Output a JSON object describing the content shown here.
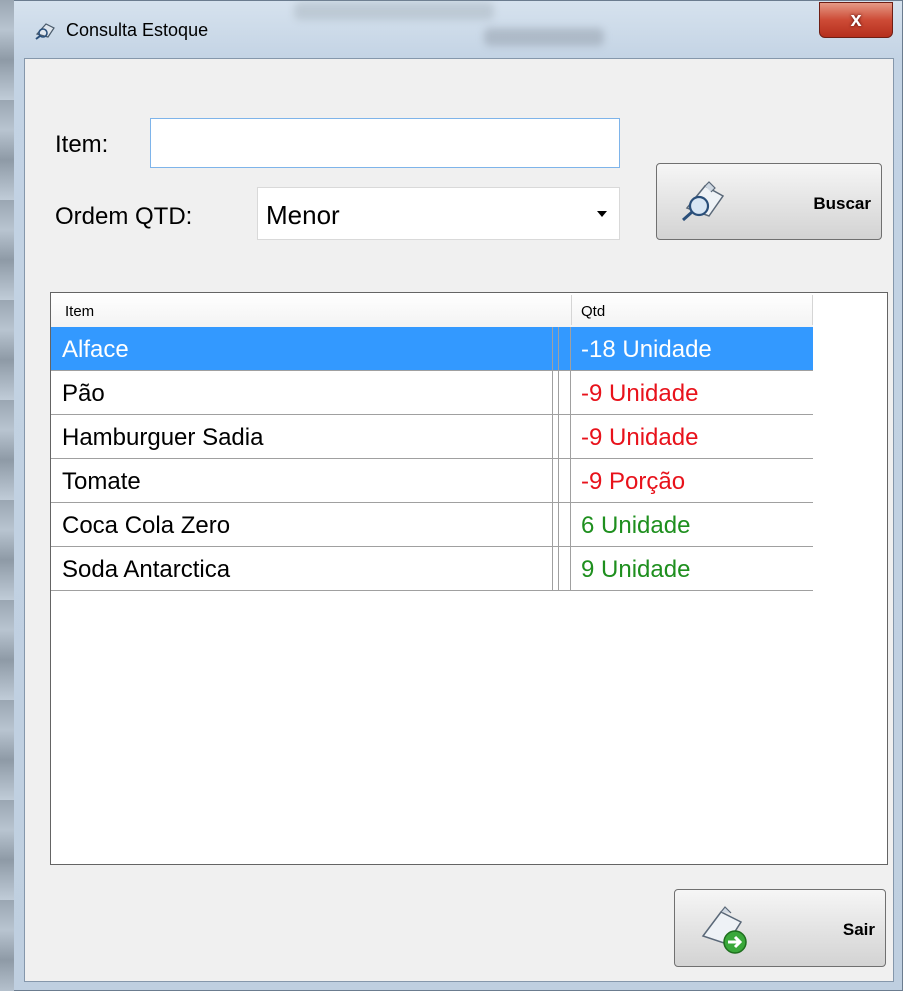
{
  "window": {
    "title": "Consulta Estoque",
    "close_label": "x"
  },
  "form": {
    "item_label": "Item:",
    "item_value": "",
    "order_label": "Ordem QTD:",
    "order_value": "Menor",
    "search_label": "Buscar",
    "exit_label": "Sair"
  },
  "grid": {
    "columns": [
      "Item",
      "Qtd"
    ],
    "rows": [
      {
        "item": "Alface",
        "qtd": "-18 Unidade",
        "status": "negative",
        "selected": true
      },
      {
        "item": "Pão",
        "qtd": "-9 Unidade",
        "status": "negative",
        "selected": false
      },
      {
        "item": "Hamburguer Sadia",
        "qtd": "-9 Unidade",
        "status": "negative",
        "selected": false
      },
      {
        "item": "Tomate",
        "qtd": "-9 Porção",
        "status": "negative",
        "selected": false
      },
      {
        "item": "Coca Cola Zero",
        "qtd": "6 Unidade",
        "status": "positive",
        "selected": false
      },
      {
        "item": "Soda Antarctica",
        "qtd": "9 Unidade",
        "status": "positive",
        "selected": false
      }
    ]
  },
  "colors": {
    "negative": "#e8121b",
    "positive": "#1e8f1e",
    "selection": "#3399ff",
    "selected_text": "#ffffff"
  }
}
